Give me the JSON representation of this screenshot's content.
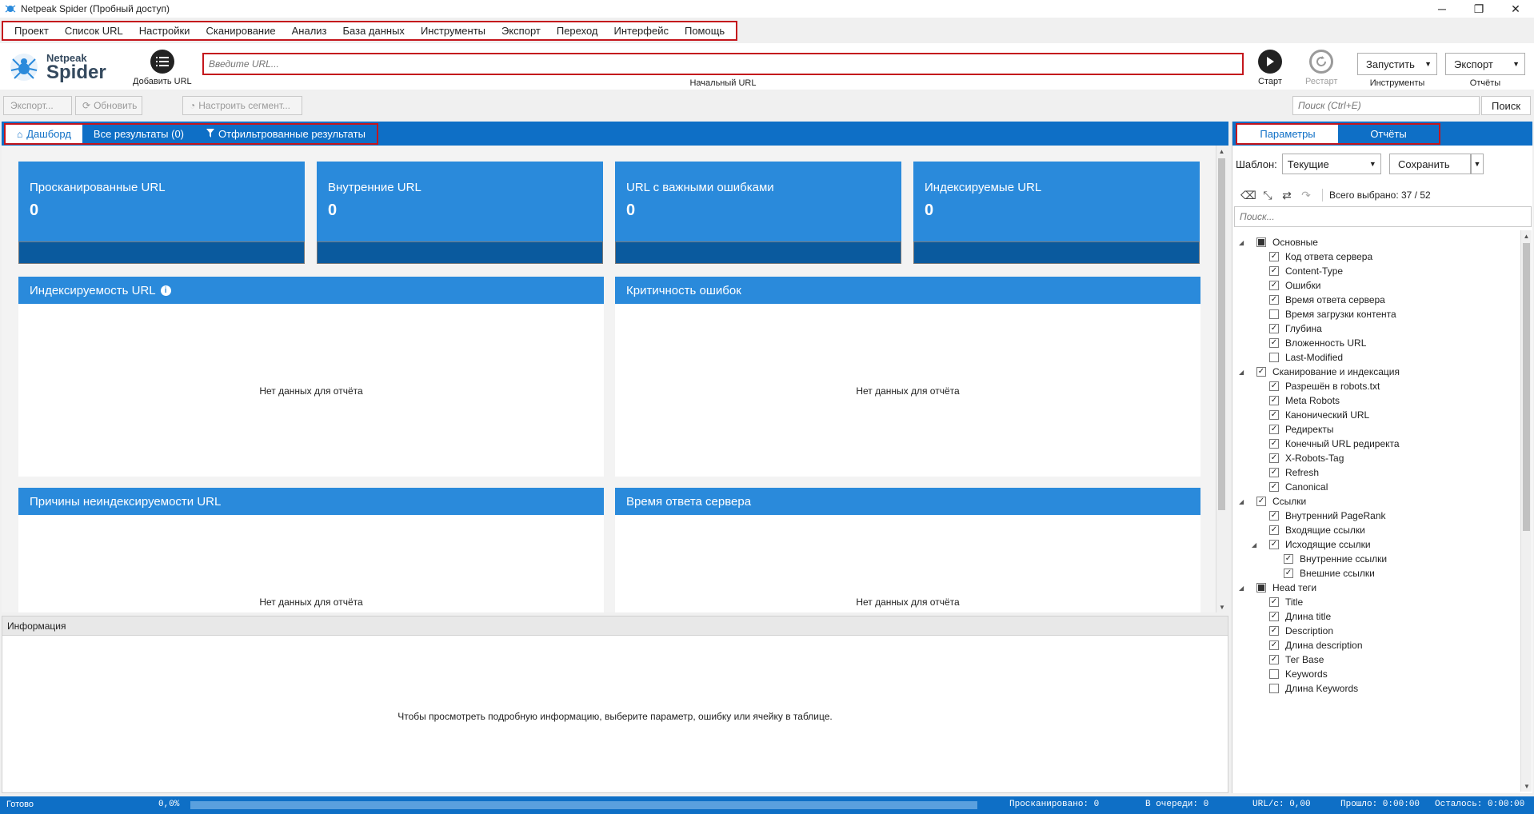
{
  "window": {
    "title": "Netpeak Spider (Пробный доступ)",
    "minimize": "─",
    "maximize": "❐",
    "close": "✕"
  },
  "menu": [
    "Проект",
    "Список URL",
    "Настройки",
    "Сканирование",
    "Анализ",
    "База данных",
    "Инструменты",
    "Экспорт",
    "Переход",
    "Интерфейс",
    "Помощь"
  ],
  "toolbar": {
    "logo_line1": "Netpeak",
    "logo_line2": "Spider",
    "add_url": "Добавить URL",
    "url_placeholder": "Введите URL...",
    "url_caption": "Начальный URL",
    "start": "Старт",
    "restart": "Рестарт",
    "run_button": "Запустить",
    "run_caption": "Инструменты",
    "export_button": "Экспорт",
    "export_caption": "Отчёты"
  },
  "actions": {
    "export": "Экспорт...",
    "refresh": "Обновить",
    "segment": "Настроить сегмент...",
    "search_placeholder": "Поиск (Ctrl+E)",
    "search_button": "Поиск"
  },
  "tabs": {
    "dashboard": "Дашборд",
    "all_results": "Все результаты (0)",
    "filtered": "Отфильтрованные результаты"
  },
  "cards": [
    {
      "title": "Просканированные URL",
      "value": "0"
    },
    {
      "title": "Внутренние URL",
      "value": "0"
    },
    {
      "title": "URL с важными ошибками",
      "value": "0"
    },
    {
      "title": "Индексируемые URL",
      "value": "0"
    }
  ],
  "panels": [
    {
      "title": "Индексируемость URL",
      "nodata": "Нет данных для отчёта"
    },
    {
      "title": "Критичность ошибок",
      "nodata": "Нет данных для отчёта"
    },
    {
      "title": "Причины неиндексируемости URL",
      "nodata": "Нет данных для отчёта"
    },
    {
      "title": "Время ответа сервера",
      "nodata": "Нет данных для отчёта"
    }
  ],
  "info": {
    "header": "Информация",
    "message": "Чтобы просмотреть подробную информацию, выберите параметр, ошибку или ячейку в таблице."
  },
  "right": {
    "tab_params": "Параметры",
    "tab_reports": "Отчёты",
    "template_label": "Шаблон:",
    "template_value": "Текущие",
    "save": "Сохранить",
    "selected": "Всего выбрано: 37 / 52",
    "search_placeholder": "Поиск...",
    "tree": [
      {
        "label": "Основные",
        "level": 0,
        "state": "partial",
        "expander": true
      },
      {
        "label": "Код ответа сервера",
        "level": 1,
        "state": "checked"
      },
      {
        "label": "Content-Type",
        "level": 1,
        "state": "checked"
      },
      {
        "label": "Ошибки",
        "level": 1,
        "state": "checked"
      },
      {
        "label": "Время ответа сервера",
        "level": 1,
        "state": "checked"
      },
      {
        "label": "Время загрузки контента",
        "level": 1,
        "state": "unchecked"
      },
      {
        "label": "Глубина",
        "level": 1,
        "state": "checked"
      },
      {
        "label": "Вложенность URL",
        "level": 1,
        "state": "checked"
      },
      {
        "label": "Last-Modified",
        "level": 1,
        "state": "unchecked"
      },
      {
        "label": "Сканирование и индексация",
        "level": 0,
        "state": "checked",
        "expander": true
      },
      {
        "label": "Разрешён в robots.txt",
        "level": 1,
        "state": "checked"
      },
      {
        "label": "Meta Robots",
        "level": 1,
        "state": "checked"
      },
      {
        "label": "Канонический URL",
        "level": 1,
        "state": "checked"
      },
      {
        "label": "Редиректы",
        "level": 1,
        "state": "checked"
      },
      {
        "label": "Конечный URL редиректа",
        "level": 1,
        "state": "checked"
      },
      {
        "label": "X-Robots-Tag",
        "level": 1,
        "state": "checked"
      },
      {
        "label": "Refresh",
        "level": 1,
        "state": "checked"
      },
      {
        "label": "Canonical",
        "level": 1,
        "state": "checked"
      },
      {
        "label": "Ссылки",
        "level": 0,
        "state": "checked",
        "expander": true
      },
      {
        "label": "Внутренний PageRank",
        "level": 1,
        "state": "checked"
      },
      {
        "label": "Входящие ссылки",
        "level": 1,
        "state": "checked"
      },
      {
        "label": "Исходящие ссылки",
        "level": 1,
        "state": "checked",
        "expander": true
      },
      {
        "label": "Внутренние ссылки",
        "level": 2,
        "state": "checked"
      },
      {
        "label": "Внешние ссылки",
        "level": 2,
        "state": "checked"
      },
      {
        "label": "Head теги",
        "level": 0,
        "state": "partial",
        "expander": true
      },
      {
        "label": "Title",
        "level": 1,
        "state": "checked"
      },
      {
        "label": "Длина title",
        "level": 1,
        "state": "checked"
      },
      {
        "label": "Description",
        "level": 1,
        "state": "checked"
      },
      {
        "label": "Длина description",
        "level": 1,
        "state": "checked"
      },
      {
        "label": "Тег Base",
        "level": 1,
        "state": "checked"
      },
      {
        "label": "Keywords",
        "level": 1,
        "state": "unchecked"
      },
      {
        "label": "Длина Keywords",
        "level": 1,
        "state": "unchecked"
      }
    ]
  },
  "status": {
    "ready": "Готово",
    "percent": "0,0%",
    "scanned": "Просканировано: 0",
    "queue": "В очереди: 0",
    "urls_per_sec": "URL/с: 0,00",
    "elapsed": "Прошло: 0:00:00",
    "remaining": "Осталось: 0:00:00"
  },
  "colors": {
    "accent": "#0e6fc6",
    "card": "#2a8adb",
    "card_bar": "#0a5a9e",
    "highlight": "#c4161c"
  }
}
